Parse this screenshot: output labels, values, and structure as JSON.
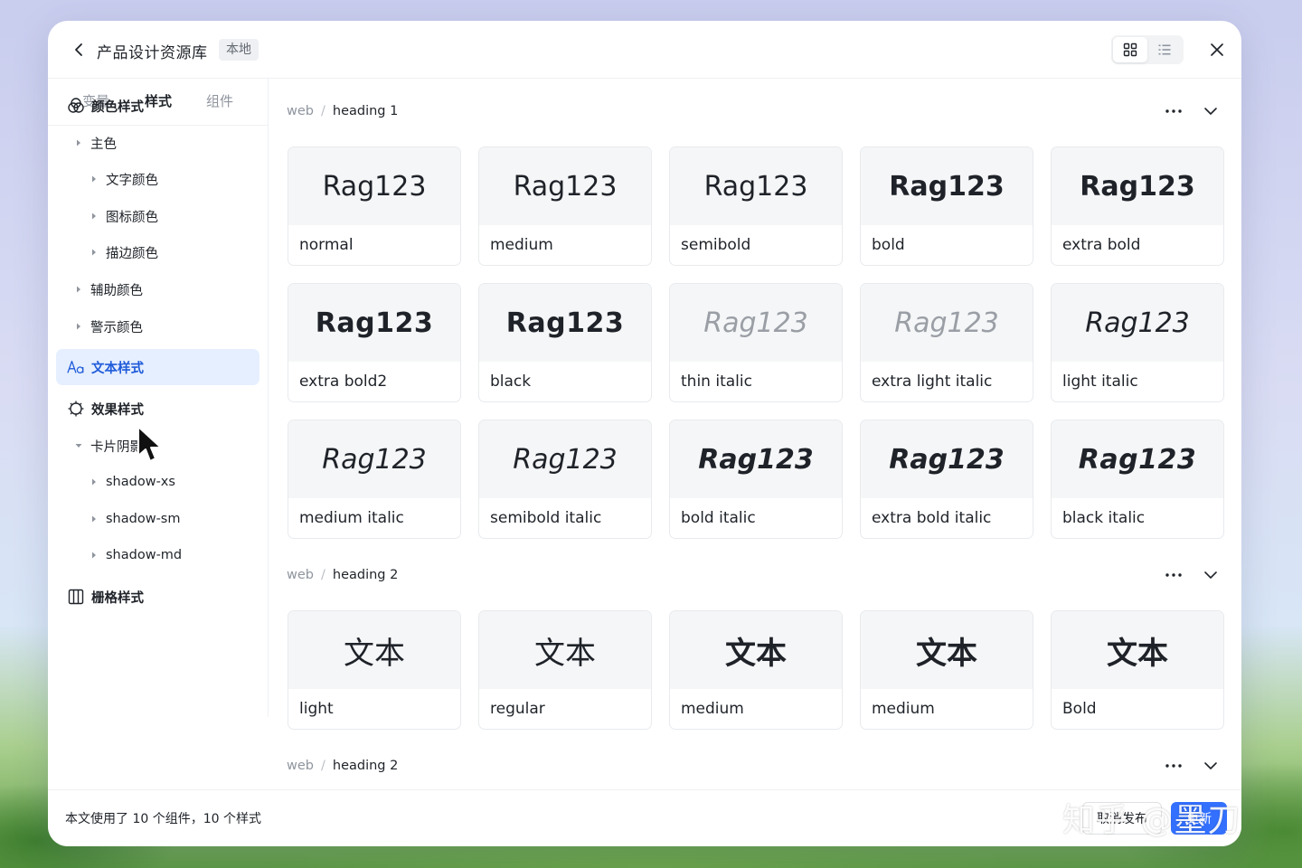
{
  "header": {
    "title": "产品设计资源库",
    "badge": "本地"
  },
  "sidebar": {
    "tabs": [
      {
        "label": "变量",
        "active": false
      },
      {
        "label": "样式",
        "active": true
      },
      {
        "label": "组件",
        "active": false
      }
    ],
    "items": [
      {
        "label": "颜色样式",
        "icon": "palette-icon",
        "level": 0,
        "bold": true
      },
      {
        "label": "主色",
        "level": 1,
        "caret": "right"
      },
      {
        "label": "文字颜色",
        "level": 2,
        "caret": "right"
      },
      {
        "label": "图标颜色",
        "level": 2,
        "caret": "right"
      },
      {
        "label": "描边颜色",
        "level": 2,
        "caret": "right"
      },
      {
        "label": "辅助颜色",
        "level": 1,
        "caret": "right"
      },
      {
        "label": "警示颜色",
        "level": 1,
        "caret": "right"
      },
      {
        "label": "文本样式",
        "icon": "text-style-icon",
        "level": 0,
        "bold": true,
        "selected": true
      },
      {
        "label": "效果样式",
        "icon": "effect-icon",
        "level": 0,
        "bold": true
      },
      {
        "label": "卡片阴影",
        "level": 1,
        "caret": "down"
      },
      {
        "label": "shadow-xs",
        "level": 2,
        "caret": "right"
      },
      {
        "label": "shadow-sm",
        "level": 2,
        "caret": "right"
      },
      {
        "label": "shadow-md",
        "level": 2,
        "caret": "right"
      },
      {
        "label": "栅格样式",
        "icon": "grid-layout-icon",
        "level": 0,
        "bold": true
      }
    ]
  },
  "sections": [
    {
      "crumb_parent": "web",
      "crumb_name": "heading 1",
      "cards": [
        {
          "preview": "Rag123",
          "label": "normal"
        },
        {
          "preview": "Rag123",
          "label": "medium"
        },
        {
          "preview": "Rag123",
          "label": "semibold"
        },
        {
          "preview": "Rag123",
          "label": "bold"
        },
        {
          "preview": "Rag123",
          "label": "extra bold"
        },
        {
          "preview": "Rag123",
          "label": "extra bold2"
        },
        {
          "preview": "Rag123",
          "label": "black"
        },
        {
          "preview": "Rag123",
          "label": "thin italic"
        },
        {
          "preview": "Rag123",
          "label": "extra light italic"
        },
        {
          "preview": "Rag123",
          "label": "light italic"
        },
        {
          "preview": "Rag123",
          "label": "medium italic"
        },
        {
          "preview": "Rag123",
          "label": "semibold italic"
        },
        {
          "preview": "Rag123",
          "label": "bold italic"
        },
        {
          "preview": "Rag123",
          "label": "extra bold italic"
        },
        {
          "preview": "Rag123",
          "label": "black italic"
        }
      ]
    },
    {
      "crumb_parent": "web",
      "crumb_name": "heading 2",
      "cards": [
        {
          "preview": "文本",
          "label": "light"
        },
        {
          "preview": "文本",
          "label": "regular"
        },
        {
          "preview": "文本",
          "label": "medium"
        },
        {
          "preview": "文本",
          "label": "medium"
        },
        {
          "preview": "文本",
          "label": "Bold"
        }
      ]
    },
    {
      "crumb_parent": "web",
      "crumb_name": "heading 2",
      "cards": []
    }
  ],
  "footer": {
    "usage_text": "本文使用了 10 个组件，10 个样式",
    "cancel_label": "取消发布",
    "primary_label": "更新"
  },
  "watermark": "知乎 @墨刀",
  "colors": {
    "accent": "#3370ff",
    "selected_bg": "#e6efff",
    "selected_text": "#1f5bd9"
  }
}
